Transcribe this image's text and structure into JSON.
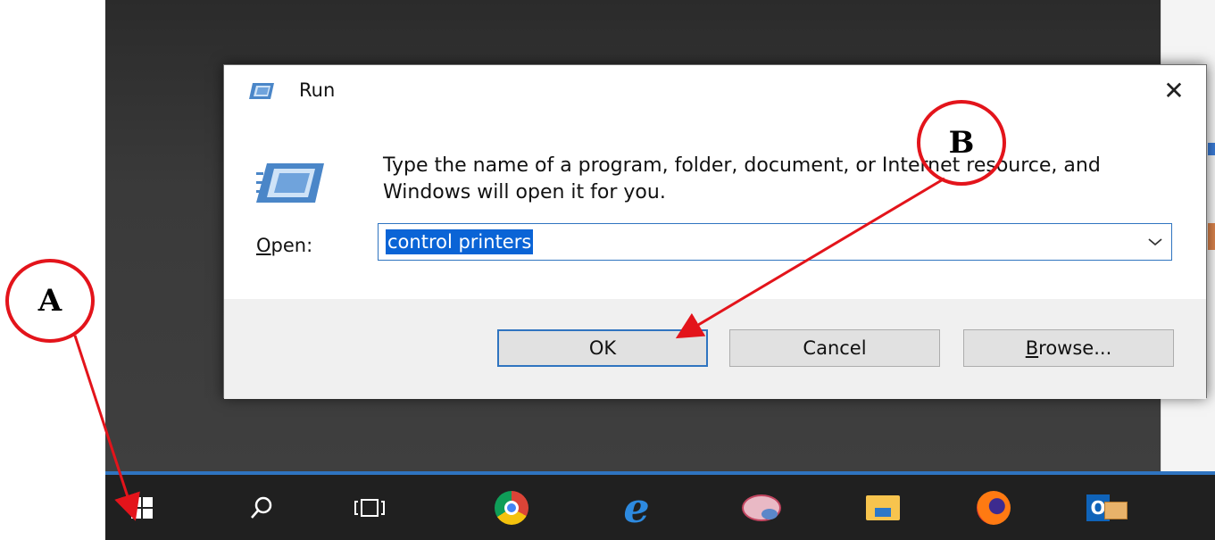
{
  "dialog": {
    "title": "Run",
    "close_symbol": "✕",
    "prompt": "Type the name of a program, folder, document, or Internet resource, and Windows will open it for you.",
    "open_label_mnemonic": "O",
    "open_label_rest": "pen:",
    "open_value": "control printers",
    "ok_label": "OK",
    "cancel_label": "Cancel",
    "browse_mnemonic": "B",
    "browse_rest": "rowse..."
  },
  "taskbar": {
    "icons": [
      "windows-start-icon",
      "search-icon",
      "task-view-icon",
      "chrome-icon",
      "internet-explorer-icon",
      "snipping-tool-icon",
      "file-explorer-icon",
      "firefox-icon",
      "outlook-icon"
    ],
    "ie_glyph": "e",
    "outlook_letter": "O"
  },
  "annotations": {
    "a_label": "A",
    "b_label": "B",
    "color": "#e3141b"
  }
}
